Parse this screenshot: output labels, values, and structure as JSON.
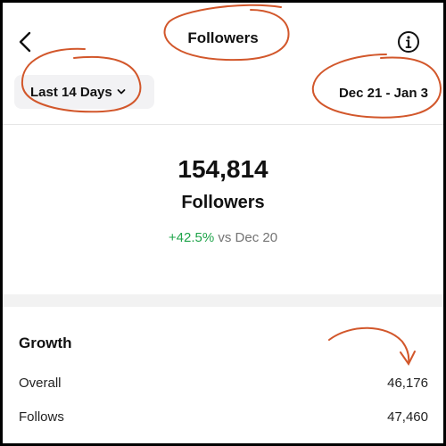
{
  "header": {
    "title": "Followers",
    "back_icon": "chevron-left-icon",
    "info_icon": "info-circle-icon"
  },
  "filters": {
    "range_label": "Last 14 Days",
    "range_chevron_icon": "chevron-down-icon",
    "date_range": "Dec 21 - Jan 3"
  },
  "summary": {
    "count": "154,814",
    "count_label": "Followers",
    "change": "+42.5%",
    "change_suffix": " vs Dec 20"
  },
  "growth": {
    "title": "Growth",
    "rows": [
      {
        "label": "Overall",
        "value": "46,176"
      },
      {
        "label": "Follows",
        "value": "47,460"
      }
    ]
  },
  "colors": {
    "positive": "#1fa44a",
    "annotation": "#d2572b",
    "muted": "#737373"
  }
}
